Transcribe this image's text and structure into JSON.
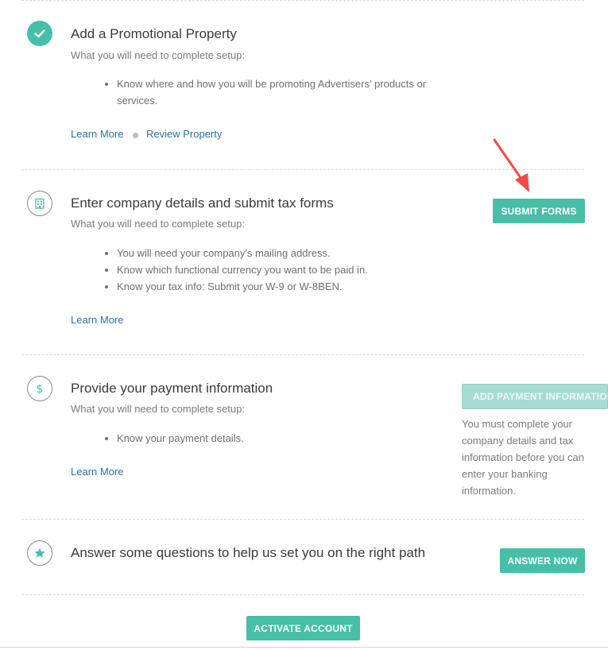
{
  "steps": [
    {
      "title": "Add a Promotional Property",
      "subtitle": "What you will need to complete setup:",
      "requirements": [
        "Know where and how you will be promoting Advertisers' products or services."
      ],
      "links": [
        "Learn More",
        "Review Property"
      ],
      "icon": "checkmark-icon",
      "status": "complete"
    },
    {
      "title": "Enter company details and submit tax forms",
      "subtitle": "What you will need to complete setup:",
      "requirements": [
        "You will need your company's mailing address.",
        "Know which functional currency you want to be paid in.",
        "Know your tax info: Submit your W-9 or W-8BEN."
      ],
      "links": [
        "Learn More"
      ],
      "icon": "building-icon",
      "button": "SUBMIT FORMS"
    },
    {
      "title": "Provide your payment information",
      "subtitle": "What you will need to complete setup:",
      "requirements": [
        "Know your payment details."
      ],
      "links": [
        "Learn More"
      ],
      "icon": "dollar-icon",
      "button": "ADD PAYMENT INFORMATION",
      "button_disabled": true,
      "note": "You must complete your company details and tax information before you can enter your banking information."
    },
    {
      "title": "Answer some questions to help us set you on the right path",
      "icon": "star-icon",
      "button": "ANSWER NOW"
    }
  ],
  "activate_button": "ACTIVATE ACCOUNT",
  "colors": {
    "accent": "#46bfa6",
    "accent_disabled": "#a6dcd0",
    "link": "#2a6fa8",
    "annotation_arrow": "#f04a4a"
  }
}
